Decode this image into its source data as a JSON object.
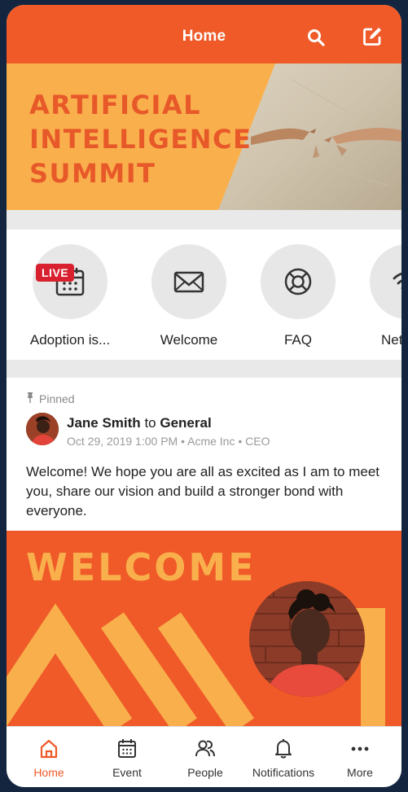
{
  "header": {
    "title": "Home",
    "search_icon": "search-icon",
    "compose_icon": "compose-icon"
  },
  "hero": {
    "title": "ARTIFICIAL\nINTELLIGENCE\nSUMMIT"
  },
  "quick_links": [
    {
      "label": "Adoption is...",
      "icon": "calendar-icon",
      "badge": "LIVE"
    },
    {
      "label": "Welcome",
      "icon": "envelope-icon"
    },
    {
      "label": "FAQ",
      "icon": "lifebuoy-icon"
    },
    {
      "label": "Netw",
      "icon": "wifi-icon"
    }
  ],
  "post": {
    "pinned_label": "Pinned",
    "author": "Jane Smith",
    "connector": "to",
    "channel": "General",
    "meta": "Oct 29, 2019 1:00 PM • Acme Inc • CEO",
    "body": "Welcome! We hope you are all as excited as I am to meet you, share our vision and build a stronger bond with everyone."
  },
  "welcome_card": {
    "title": "WELCOME"
  },
  "bottom_nav": [
    {
      "label": "Home",
      "icon": "home-icon",
      "active": true
    },
    {
      "label": "Event",
      "icon": "calendar-icon"
    },
    {
      "label": "People",
      "icon": "people-icon"
    },
    {
      "label": "Notifications",
      "icon": "bell-icon"
    },
    {
      "label": "More",
      "icon": "more-icon"
    }
  ],
  "colors": {
    "brand": "#ef5a28",
    "accent": "#f9b04c",
    "live": "#d8202e",
    "background": "#14263f"
  }
}
